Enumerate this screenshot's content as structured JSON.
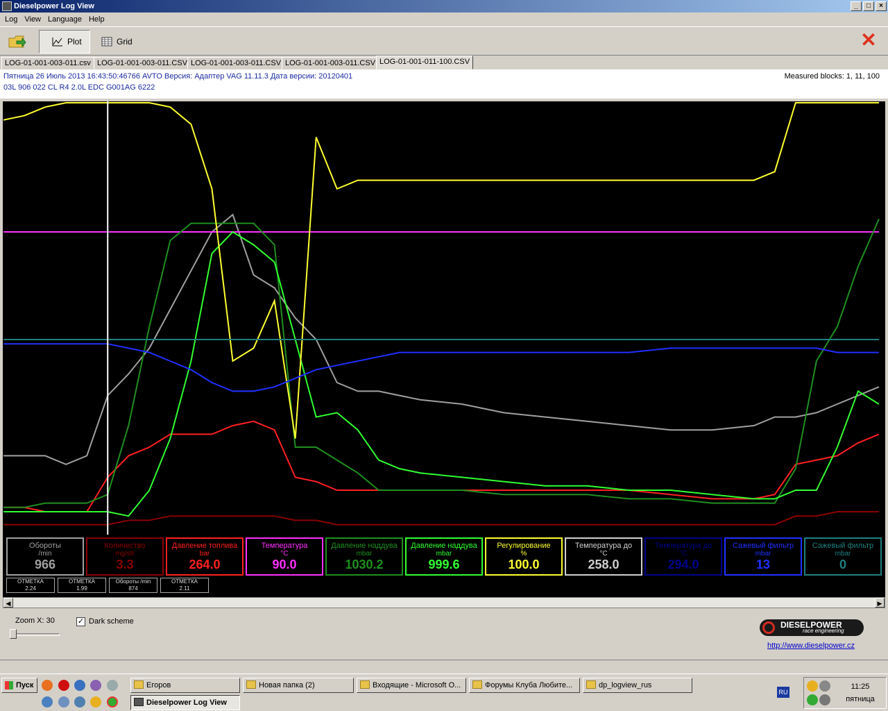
{
  "window": {
    "title": "Dieselpower Log View"
  },
  "menu": [
    "Log",
    "View",
    "Language",
    "Help"
  ],
  "toolbar": {
    "plot_label": "Plot",
    "grid_label": "Grid"
  },
  "tabs": [
    "LOG-01-001-003-011.csv",
    "LOG-01-001-003-011.CSV",
    "LOG-01-001-003-011.CSV",
    "LOG-01-001-003-011.CSV",
    "LOG-01-001-011-100.CSV"
  ],
  "info": {
    "line1": "Пятница 26 Июль 2013 16:43:50:46766 AVTO Версия: Адаптер VAG 11.11.3 Дата версии: 20120401",
    "line2": "03L 906 022 CL   R4 2.0L EDC G001AG  6222",
    "measured": "Measured blocks: 1, 11, 100"
  },
  "gauges": [
    {
      "name": "Обороты",
      "unit": "/min",
      "value": "966",
      "color": "#a0a0a0"
    },
    {
      "name": "Количество",
      "unit": "mg/str",
      "value": "3.3",
      "color": "#8b0000"
    },
    {
      "name": "Давление топлива",
      "unit": "bar",
      "value": "264.0",
      "color": "#ff2020"
    },
    {
      "name": "Температура",
      "unit": "°C",
      "value": "90.0",
      "color": "#ff30ff"
    },
    {
      "name": "Давление наддува",
      "unit": "mbar",
      "value": "1030.2",
      "color": "#1f8f1f"
    },
    {
      "name": "Давление наддува",
      "unit": "mbar",
      "value": "999.6",
      "color": "#30ff30"
    },
    {
      "name": "Регулирование",
      "unit": "%",
      "value": "100.0",
      "color": "#ffff30"
    },
    {
      "name": "Температура до",
      "unit": "°C",
      "value": "258.0",
      "color": "#d0d0d0"
    },
    {
      "name": "Температура до",
      "unit": "°C",
      "value": "294.0",
      "color": "#00008b"
    },
    {
      "name": "Сажевый фильтр",
      "unit": "mbar",
      "value": "13",
      "color": "#2030ff"
    },
    {
      "name": "Сажевый фильтр",
      "unit": "mbar",
      "value": "0",
      "color": "#208080"
    }
  ],
  "marks": [
    {
      "label": "ОТМЕТКА",
      "value": "2.24"
    },
    {
      "label": "ОТМЕТКА",
      "value": "1.99"
    },
    {
      "label": "Обороты /min",
      "value": "874"
    },
    {
      "label": "ОТМЕТКА",
      "value": "2.11"
    }
  ],
  "bottom": {
    "zoom_label": "Zoom X: 30",
    "dark_scheme_label": "Dark scheme",
    "dark_scheme_checked": true,
    "logo_text": "DIESELPOWER",
    "logo_sub": "race engineering",
    "link": "http://www.dieselpower.cz"
  },
  "taskbar": {
    "start": "Пуск",
    "tasks": [
      "Егоров",
      "Новая папка (2)",
      "Входящие - Microsoft O...",
      "Форумы Клуба Любите...",
      "dp_logview_rus"
    ],
    "active_task": "Dieselpower Log View",
    "lang": "RU",
    "time": "11:25",
    "day": "пятница"
  },
  "chart_data": {
    "type": "line",
    "cursor_x": 25,
    "x": [
      0,
      5,
      10,
      15,
      20,
      25,
      30,
      35,
      40,
      45,
      50,
      55,
      60,
      65,
      70,
      75,
      80,
      85,
      90,
      95,
      100,
      110,
      120,
      130,
      140,
      150,
      160,
      170,
      180,
      185,
      190,
      195,
      200,
      205,
      210
    ],
    "series": [
      {
        "color": "#a0a0a0",
        "values": [
          18,
          18,
          18,
          16,
          18,
          32,
          37,
          43,
          52,
          61,
          70,
          74,
          60,
          57,
          50,
          45,
          35,
          33,
          33,
          32,
          31,
          30,
          28,
          27,
          26,
          25,
          24,
          24,
          25,
          27,
          27,
          28,
          30,
          32,
          34
        ]
      },
      {
        "color": "#8b0000",
        "values": [
          2,
          2,
          2,
          2,
          2,
          2,
          3,
          3,
          4,
          4,
          4,
          4,
          4,
          4,
          3,
          3,
          2,
          2,
          2,
          2,
          2,
          2,
          2,
          2,
          2,
          2,
          2,
          2,
          2,
          2,
          4,
          4,
          5,
          5,
          5
        ]
      },
      {
        "color": "#ff2020",
        "values": [
          6,
          6,
          5,
          5,
          5,
          13,
          18,
          20,
          23,
          23,
          23,
          25,
          26,
          24,
          13,
          12,
          10,
          10,
          10,
          10,
          10,
          10,
          10,
          10,
          10,
          10,
          9,
          8,
          8,
          9,
          16,
          17,
          18,
          21,
          23
        ]
      },
      {
        "color": "#ff30ff",
        "values": [
          70,
          70,
          70,
          70,
          70,
          70,
          70,
          70,
          70,
          70,
          70,
          70,
          70,
          70,
          70,
          70,
          70,
          70,
          70,
          70,
          70,
          70,
          70,
          70,
          70,
          70,
          70,
          70,
          70,
          70,
          70,
          70,
          70,
          70,
          70
        ]
      },
      {
        "color": "#1f8f1f",
        "values": [
          6,
          6,
          7,
          7,
          7,
          9,
          25,
          48,
          68,
          72,
          72,
          72,
          72,
          67,
          20,
          20,
          17,
          14,
          10,
          10,
          10,
          10,
          9,
          9,
          9,
          8,
          8,
          7,
          7,
          7,
          15,
          40,
          48,
          62,
          73
        ]
      },
      {
        "color": "#30ff30",
        "values": [
          5,
          5,
          5,
          5,
          5,
          5,
          4,
          10,
          22,
          40,
          65,
          70,
          67,
          63,
          45,
          27,
          28,
          24,
          17,
          15,
          14,
          13,
          12,
          11,
          11,
          10,
          10,
          9,
          8,
          8,
          10,
          10,
          20,
          33,
          30
        ]
      },
      {
        "color": "#ffff30",
        "values": [
          96,
          97,
          99,
          100,
          100,
          100,
          100,
          100,
          99,
          95,
          80,
          40,
          43,
          54,
          22,
          92,
          80,
          82,
          82,
          82,
          82,
          82,
          82,
          82,
          82,
          82,
          82,
          82,
          82,
          84,
          100,
          100,
          100,
          100,
          100
        ]
      },
      {
        "color": "#2030ff",
        "values": [
          44,
          44,
          44,
          44,
          44,
          44,
          43,
          42,
          40,
          38,
          35,
          33,
          33,
          34,
          36,
          38,
          39,
          40,
          41,
          42,
          42,
          42,
          42,
          42,
          42,
          42,
          43,
          43,
          43,
          43,
          43,
          43,
          42,
          42,
          42
        ]
      },
      {
        "color": "#208080",
        "values": [
          45,
          45,
          45,
          45,
          45,
          45,
          45,
          45,
          45,
          45,
          45,
          45,
          45,
          45,
          45,
          45,
          45,
          45,
          45,
          45,
          45,
          45,
          45,
          45,
          45,
          45,
          45,
          45,
          45,
          45,
          45,
          45,
          45,
          45,
          45
        ]
      }
    ]
  }
}
